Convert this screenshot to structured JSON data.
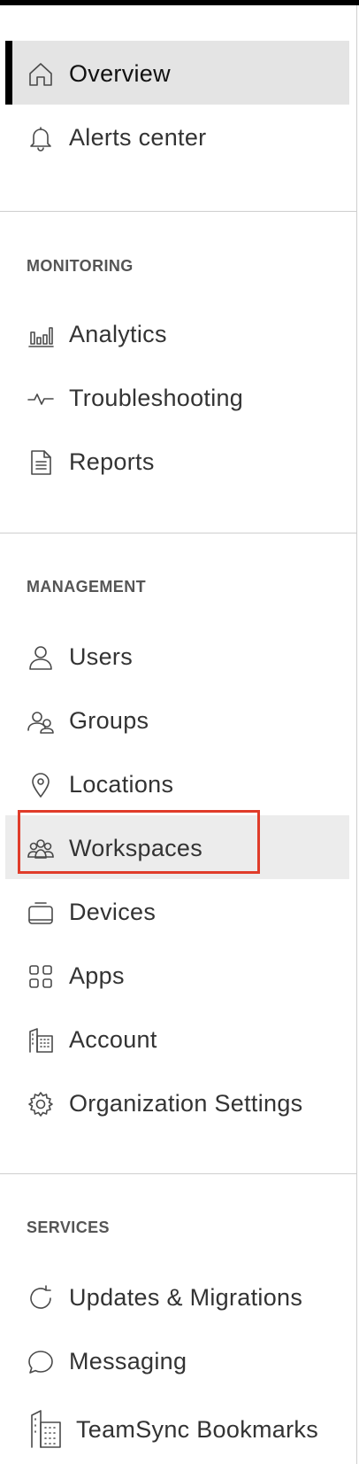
{
  "nav": {
    "top": [
      {
        "label": "Overview",
        "icon": "home-icon",
        "active": true
      },
      {
        "label": "Alerts center",
        "icon": "bell-icon"
      }
    ],
    "sections": [
      {
        "title": "MONITORING",
        "items": [
          {
            "label": "Analytics",
            "icon": "bar-chart-icon"
          },
          {
            "label": "Troubleshooting",
            "icon": "pulse-icon"
          },
          {
            "label": "Reports",
            "icon": "document-icon"
          }
        ]
      },
      {
        "title": "MANAGEMENT",
        "items": [
          {
            "label": "Users",
            "icon": "user-icon"
          },
          {
            "label": "Groups",
            "icon": "users-icon"
          },
          {
            "label": "Locations",
            "icon": "location-pin-icon"
          },
          {
            "label": "Workspaces",
            "icon": "workspaces-icon",
            "highlighted": true
          },
          {
            "label": "Devices",
            "icon": "device-icon"
          },
          {
            "label": "Apps",
            "icon": "apps-grid-icon"
          },
          {
            "label": "Account",
            "icon": "building-icon"
          },
          {
            "label": "Organization Settings",
            "icon": "gear-icon"
          }
        ]
      },
      {
        "title": "SERVICES",
        "items": [
          {
            "label": "Updates & Migrations",
            "icon": "refresh-icon"
          },
          {
            "label": "Messaging",
            "icon": "chat-bubble-icon"
          },
          {
            "label": "TeamSync Bookmarks",
            "icon": "bookmark-building-icon"
          }
        ]
      }
    ]
  },
  "colors": {
    "highlight_border": "#e03c2a",
    "active_bar": "#000000",
    "active_bg": "#e4e4e4"
  }
}
